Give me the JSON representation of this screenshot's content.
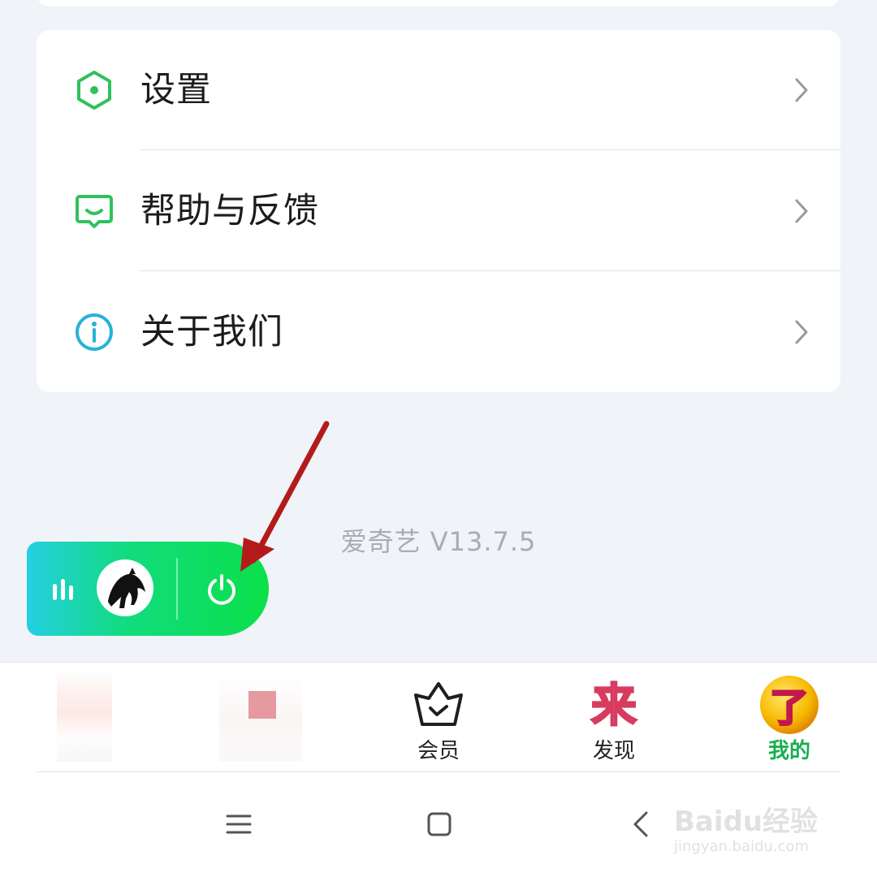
{
  "menu": {
    "items": [
      {
        "label": "设置",
        "icon": "settings-hexagon-icon",
        "color": "#2fc25b"
      },
      {
        "label": "帮助与反馈",
        "icon": "feedback-message-icon",
        "color": "#2fc25b"
      },
      {
        "label": "关于我们",
        "icon": "info-circle-icon",
        "color": "#27b2d9"
      }
    ]
  },
  "version": "爱奇艺 V13.7.5",
  "mini_player": {
    "icons": [
      "sound-wave-icon",
      "album-cover",
      "power-icon"
    ],
    "gradient": [
      "#25cfe3",
      "#0be049"
    ]
  },
  "bottom_nav": {
    "items": [
      {
        "label": "",
        "icon": "blurred-tab-icon"
      },
      {
        "label": "",
        "icon": "blurred-tab-icon"
      },
      {
        "label": "会员",
        "icon": "vip-crown-basket-icon"
      },
      {
        "label": "发现",
        "icon": "discover-lai-icon",
        "glyph": "来"
      },
      {
        "label": "我的",
        "icon": "mine-le-icon",
        "glyph": "了",
        "active": true
      }
    ],
    "active_color": "#16b04f"
  },
  "system_nav": [
    "menu-icon",
    "home-square-icon",
    "back-chevron-icon"
  ],
  "watermark": {
    "logo": "Baidu经验",
    "url": "jingyan.baidu.com"
  },
  "annotation": {
    "color": "#b31b1b",
    "target": "power-icon"
  }
}
